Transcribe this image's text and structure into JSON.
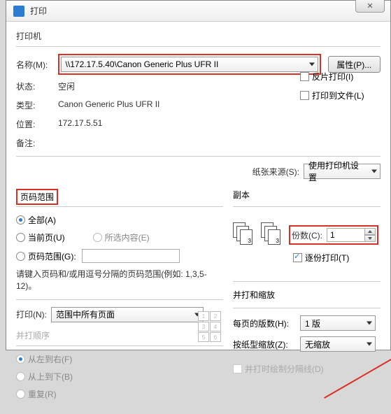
{
  "titlebar": {
    "title": "打印",
    "close": "✕"
  },
  "printer": {
    "section_title": "打印机",
    "name_label": "名称(M):",
    "name_value": "\\\\172.17.5.40\\Canon Generic Plus UFR II",
    "prop_button": "属性(P)...",
    "status_label": "状态:",
    "status_value": "空闲",
    "type_label": "类型:",
    "type_value": "Canon Generic Plus UFR II",
    "where_label": "位置:",
    "where_value": "172.17.5.51",
    "comment_label": "备注:",
    "flip_print": "反片打印(I)",
    "print_to_file": "打印到文件(L)"
  },
  "paper": {
    "source_label": "纸张来源(S):",
    "source_value": "使用打印机设置"
  },
  "range": {
    "title": "页码范围",
    "all": "全部(A)",
    "current": "当前页(U)",
    "selection": "所选内容(E)",
    "pages": "页码范围(G):",
    "hint": "请键入页码和/或用逗号分隔的页码范围(例如: 1,3,5-12)。"
  },
  "copies": {
    "title": "副本",
    "count_label": "份数(C):",
    "count_value": "1",
    "collate": "逐份打印(T)"
  },
  "print_what": {
    "label": "打印(N):",
    "value": "范围中所有页面"
  },
  "order": {
    "title": "并打顺序",
    "ltr": "从左到右(F)",
    "ttb": "从上到下(B)",
    "repeat": "重复(R)"
  },
  "scale": {
    "title": "并打和缩放",
    "pages_per_label": "每页的版数(H):",
    "pages_per_value": "1 版",
    "scale_label": "按纸型缩放(Z):",
    "scale_value": "无缩放",
    "draw_border": "并打时绘制分隔线(D)"
  },
  "thumbs": [
    "1",
    "2",
    "3",
    "4",
    "5",
    "6"
  ]
}
